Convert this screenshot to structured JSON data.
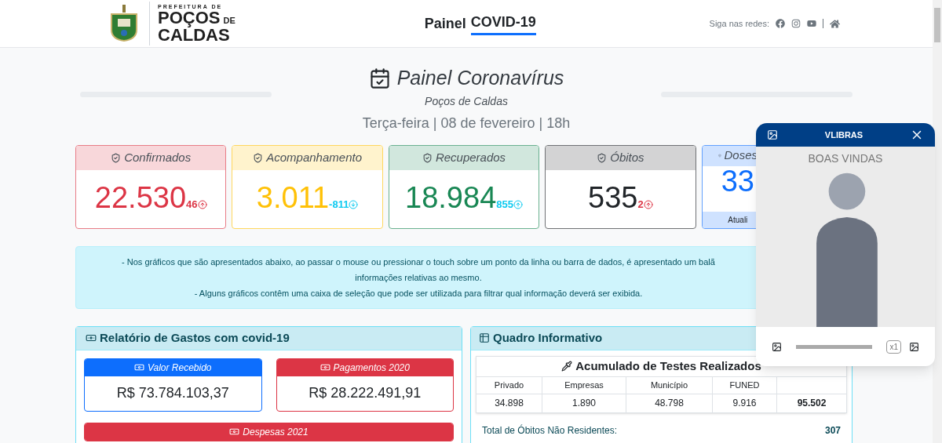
{
  "header": {
    "logo_small": "PREFEITURA DE",
    "logo_line1": "POÇOS",
    "logo_de": "DE",
    "logo_line2": "CALDAS",
    "title_prefix": "Painel",
    "title_main": "COVID-19",
    "social_label": "Siga nas redes:"
  },
  "hero": {
    "title": "Painel Coronavírus",
    "subtitle": "Poços de Caldas",
    "date": "Terça-feira | 08 de fevereiro | 18h"
  },
  "stats": [
    {
      "color": "#dc3545",
      "label": "Confirmados",
      "value": "22.530",
      "delta": {
        "text": "46",
        "kind": "up",
        "color": "#dc3545"
      }
    },
    {
      "color": "#ffc107",
      "label": "Acompanhamento",
      "value": "3.011",
      "delta": {
        "text": "-811",
        "kind": "down",
        "color": "#0dcaf0"
      }
    },
    {
      "color": "#198754",
      "label": "Recuperados",
      "value": "18.984",
      "delta": {
        "text": "855",
        "kind": "up",
        "color": "#0dcaf0"
      }
    },
    {
      "color": "#212529",
      "label": "Óbitos",
      "value": "535",
      "delta": {
        "text": "2",
        "kind": "up",
        "color": "#dc3545"
      }
    },
    {
      "color": "#0d6efd",
      "label": "Doses",
      "value": "33",
      "footer": "Atuali"
    }
  ],
  "info": [
    "- Nos gráficos que são apresentados abaixo, ao passar o mouse ou pressionar o touch sobre um ponto da linha ou barra de dados, é apresentado um balã",
    "informações relativas ao mesmo.",
    "- Alguns gráficos contêm uma caixa de seleção que pode ser utilizada para filtrar qual informação deverá ser exibida."
  ],
  "expenses": {
    "title": "Relatório de Gastos com covid-19",
    "items": [
      {
        "color": "#0d6efd",
        "label": "Valor Recebido",
        "value": "R$ 73.784.103,37"
      },
      {
        "color": "#dc3545",
        "label": "Pagamentos 2020",
        "value": "R$ 28.222.491,91"
      },
      {
        "color": "#dc3545",
        "label": "Despesas 2021"
      }
    ]
  },
  "board": {
    "title": "Quadro Informativo",
    "table_title": "Acumulado de Testes Realizados",
    "columns": [
      "Privado",
      "Empresas",
      "Município",
      "FUNED"
    ],
    "values": [
      "34.898",
      "1.890",
      "48.798",
      "9.916",
      "95.502"
    ],
    "rows": [
      {
        "label": "Total de Óbitos Não Residentes:",
        "value": "307"
      }
    ]
  },
  "vlibras": {
    "title": "VLIBRAS",
    "caption": "BOAS VINDAS",
    "speed": "x1",
    "level": 1
  }
}
